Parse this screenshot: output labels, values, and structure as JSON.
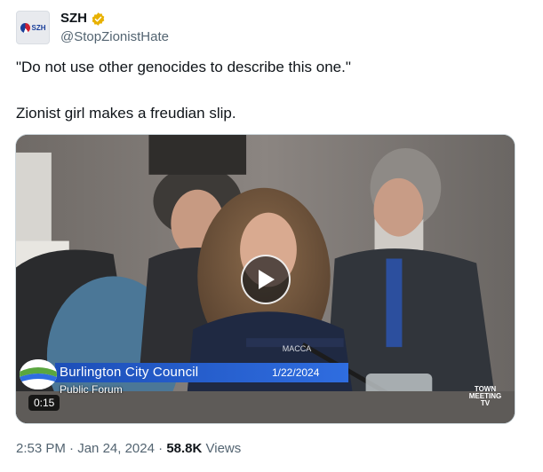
{
  "author": {
    "display_name": "SZH",
    "handle": "@StopZionistHate",
    "avatar_text": "SZH",
    "verified_badge_color": "#e8b100"
  },
  "tweet": {
    "line1": "\"Do not use other genocides to describe this one.\"",
    "line2": "Zionist girl makes a freudian slip."
  },
  "media": {
    "type": "video",
    "duration": "0:15",
    "lower_third_title": "Burlington City Council",
    "lower_third_date": "1/22/2024",
    "lower_third_subtitle": "Public Forum",
    "channel_logo": "TOWN MEETING TV",
    "shirt_text": "MACCA",
    "bar_color": "#2459c8"
  },
  "footer": {
    "time": "2:53 PM",
    "separator": "·",
    "date": "Jan 24, 2024",
    "views_count": "58.8K",
    "views_label": "Views"
  }
}
